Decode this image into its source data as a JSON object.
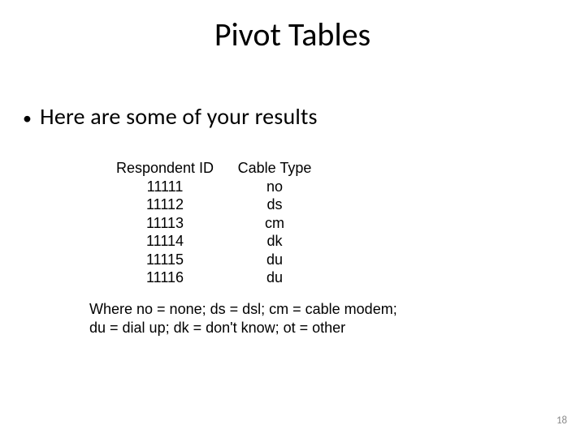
{
  "title": "Pivot Tables",
  "bullet": "Here are some of your results",
  "table": {
    "headers": {
      "id": "Respondent ID",
      "type": "Cable Type"
    },
    "rows": [
      {
        "id": "11111",
        "type": "no"
      },
      {
        "id": "11112",
        "type": "ds"
      },
      {
        "id": "11113",
        "type": "cm"
      },
      {
        "id": "11114",
        "type": "dk"
      },
      {
        "id": "11115",
        "type": "du"
      },
      {
        "id": "11116",
        "type": "du"
      }
    ]
  },
  "legend_line1": "Where no = none; ds = dsl; cm = cable modem;",
  "legend_line2": "du = dial up; dk = don't know; ot = other",
  "page_number": "18"
}
